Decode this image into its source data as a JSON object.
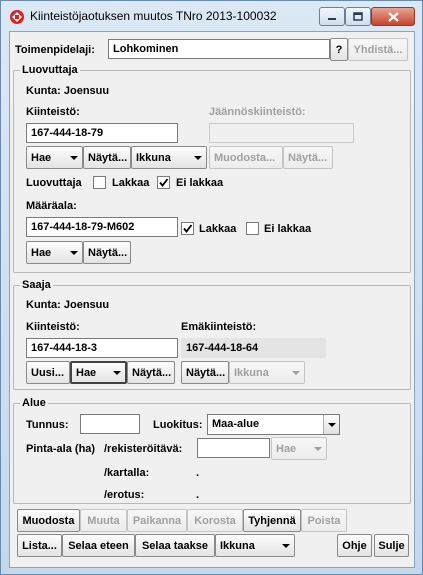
{
  "window": {
    "title": "Kiinteistöjaotuksen muutos TNro 2013-100032"
  },
  "top": {
    "toimenpidelaji_label": "Toimenpidelaji:",
    "toimenpidelaji_value": "Lohkominen",
    "help_label": "?",
    "yhdista_label": "Yhdistä..."
  },
  "luovuttaja": {
    "group_label": "Luovuttaja",
    "kunta": "Kunta:  Joensuu",
    "kiinteisto_label": "Kiinteistö:",
    "kiinteisto_value": "167-444-18-79",
    "jaannos_label": "Jäännöskiinteistö:",
    "jaannos_value": "",
    "buttons": {
      "hae": "Hae",
      "nayta": "Näytä...",
      "ikkuna": "Ikkuna",
      "muodosta": "Muodosta...",
      "nayta2": "Näytä..."
    },
    "lakkaa_row_label": "Luovuttaja",
    "lakkaa_label": "Lakkaa",
    "lakkaa_checked": false,
    "ei_lakkaa_label": "Ei lakkaa",
    "ei_lakkaa_checked": true,
    "maaraala_label": "Määräala:",
    "maaraala_value": "167-444-18-79-M602",
    "ma_lakkaa_label": "Lakkaa",
    "ma_lakkaa_checked": true,
    "ma_ei_lakkaa_label": "Ei lakkaa",
    "ma_ei_lakkaa_checked": false,
    "ma_buttons": {
      "hae": "Hae",
      "nayta": "Näytä..."
    }
  },
  "saaja": {
    "group_label": "Saaja",
    "kunta": "Kunta:  Joensuu",
    "kiinteisto_label": "Kiinteistö:",
    "kiinteisto_value": "167-444-18-3",
    "emakiinteisto_label": "Emäkiinteistö:",
    "emakiinteisto_value": "167-444-18-64",
    "buttons": {
      "uusi": "Uusi...",
      "hae": "Hae",
      "nayta": "Näytä...",
      "nayta2": "Näytä...",
      "ikkuna": "Ikkuna"
    }
  },
  "alue": {
    "group_label": "Alue",
    "tunnus_label": "Tunnus:",
    "tunnus_value": "",
    "luokitus_label": "Luokitus:",
    "luokitus_value": "Maa-alue",
    "pinta_ala_label": "Pinta-ala (ha)",
    "rekisteroitava_label": "/rekisteröitävä:",
    "rekisteroitava_value": "",
    "hae_label": "Hae",
    "kartalla_label": "/kartalla:",
    "kartalla_value": ".",
    "erotus_label": "/erotus:",
    "erotus_value": "."
  },
  "actions": {
    "muodosta": "Muodosta",
    "muuta": "Muuta",
    "paikanna": "Paikanna",
    "korosta": "Korosta",
    "tyhjenna": "Tyhjennä",
    "poista": "Poista"
  },
  "bottom": {
    "lista": "Lista...",
    "selaa_eteen": "Selaa eteen",
    "selaa_taakse": "Selaa taakse",
    "ikkuna": "Ikkuna",
    "ohje": "Ohje",
    "sulje": "Sulje"
  },
  "colors": {
    "close_button": "#c7452c",
    "app_icon": "#e02020"
  }
}
